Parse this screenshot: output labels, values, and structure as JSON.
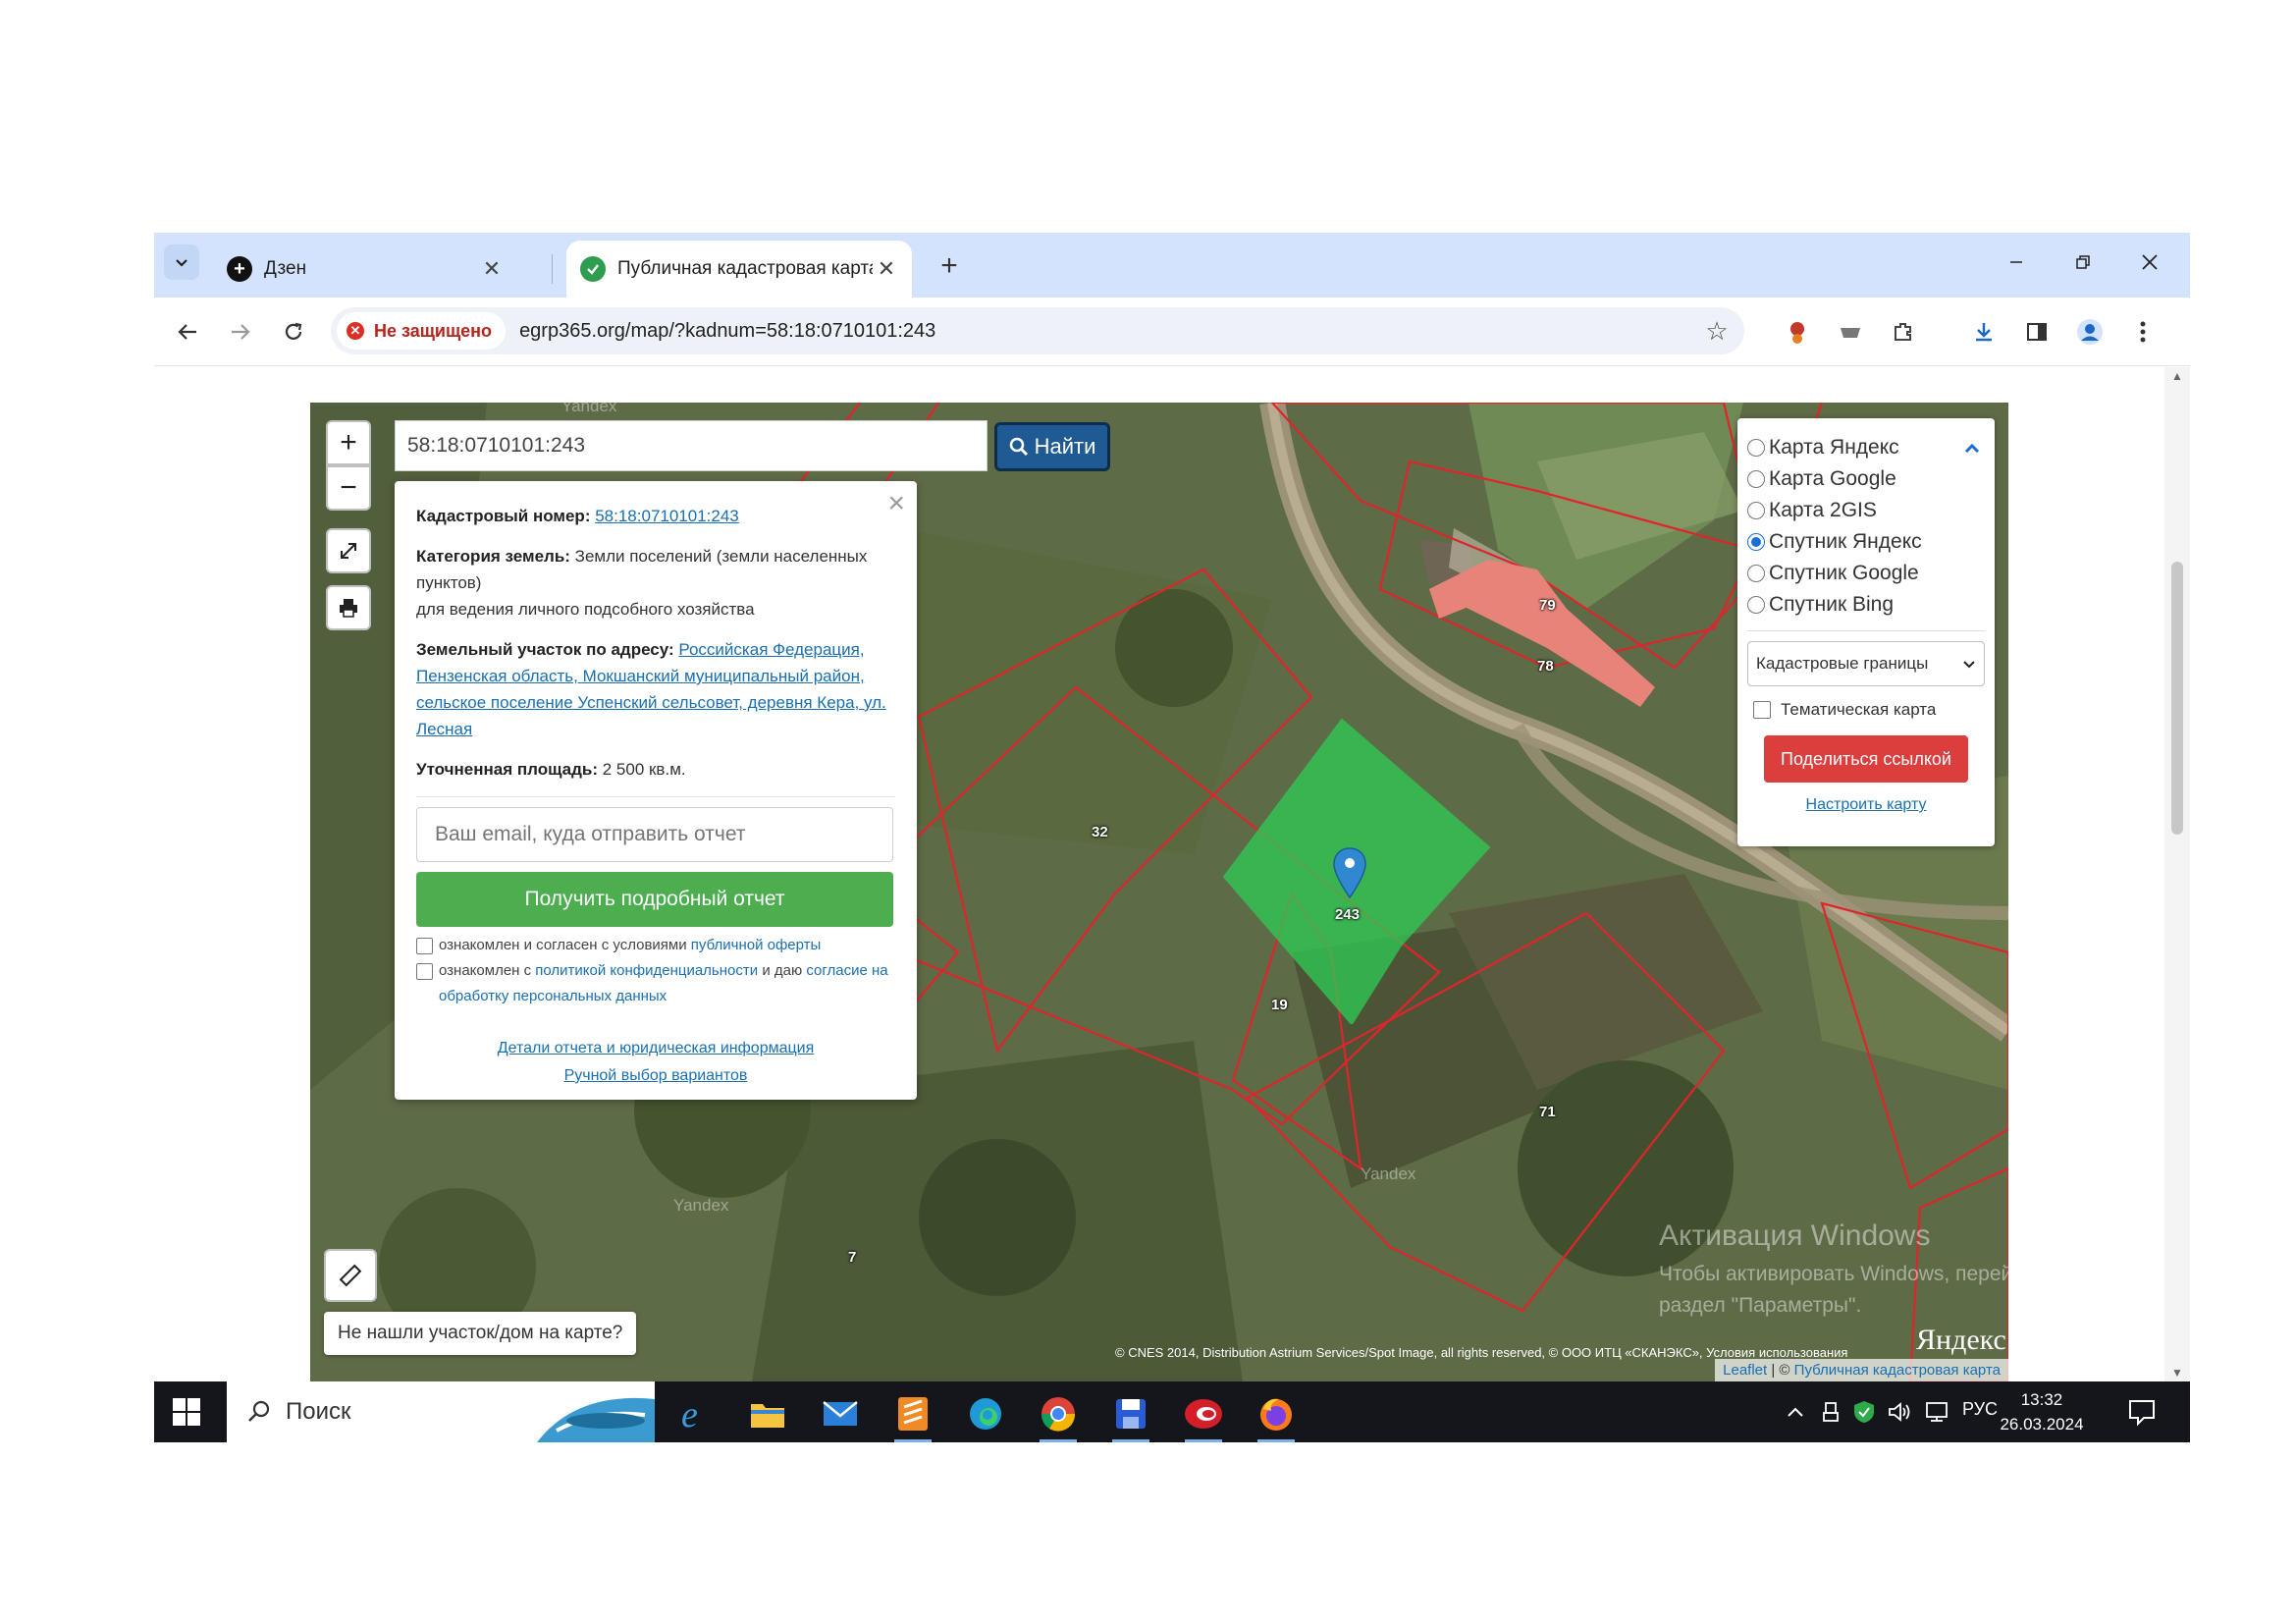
{
  "browser": {
    "tabs": [
      {
        "title": "Дзен",
        "active": false
      },
      {
        "title": "Публичная кадастровая карта",
        "active": true
      }
    ],
    "security_label": "Не защищено",
    "url": "egrp365.org/map/?kadnum=58:18:0710101:243"
  },
  "map": {
    "search_value": "58:18:0710101:243",
    "search_button": "Найти",
    "zoom_in": "+",
    "zoom_out": "−",
    "popup": {
      "cadastral_label": "Кадастровый номер:",
      "cadastral_value": "58:18:0710101:243",
      "category_label": "Категория земель:",
      "category_value": "Земли поселений (земли населенных пунктов)",
      "usage": "для ведения личного подсобного хозяйства",
      "address_label": "Земельный участок по адресу:",
      "address_value": "Российская Федерация, Пензенская область, Мокшанский муниципальный район, сельское поселение Успенский сельсовет, деревня Кера, ул. Лесная",
      "area_label": "Уточненная площадь:",
      "area_value": "2 500 кв.м.",
      "email_placeholder": "Ваш email, куда отправить отчет",
      "report_button": "Получить подробный отчет",
      "consent1_text": "ознакомлен и согласен с условиями",
      "consent1_link": "публичной оферты",
      "consent2_text": "ознакомлен с",
      "consent2_link": "политикой конфиденциальности",
      "consent2_text2": "и даю",
      "consent2_link2": "согласие на обработку персональных данных",
      "details_link": "Детали отчета и юридическая информация",
      "manual_link": "Ручной выбор вариантов"
    },
    "layers": {
      "options": [
        {
          "label": "Карта Яндекс",
          "selected": false
        },
        {
          "label": "Карта Google",
          "selected": false
        },
        {
          "label": "Карта 2GIS",
          "selected": false
        },
        {
          "label": "Спутник Яндекс",
          "selected": true
        },
        {
          "label": "Спутник Google",
          "selected": false
        },
        {
          "label": "Спутник Bing",
          "selected": false
        }
      ],
      "select_value": "Кадастровые границы",
      "thematic_label": "Тематическая карта",
      "share_button": "Поделиться ссылкой",
      "setup_link": "Настроить карту"
    },
    "plot_labels": [
      "79",
      "78",
      "32",
      "243",
      "19",
      "71",
      "7"
    ],
    "yandex_watermark": "Yandex",
    "not_found_button": "Не нашли участок/дом на карте?",
    "copyright": "© CNES 2014, Distribution Astrium Services/Spot Image, all rights reserved, © ООО ИТЦ «СКАНЭКС», Условия использования",
    "attribution_leaflet": "Leaflet",
    "attribution_sep": " | © ",
    "attribution_source": "Публичная кадастровая карта",
    "yandex_logo": "Яндекс",
    "parcel_color": "#2ecc55",
    "building_color": "#e8837a",
    "boundary_color": "#e0242b"
  },
  "os": {
    "activation_title": "Активация Windows",
    "activation_sub": "Чтобы активировать Windows, перейдите в раздел \"Параметры\".",
    "search_label": "Поиск",
    "language": "РУС",
    "time": "13:32",
    "date": "26.03.2024"
  }
}
